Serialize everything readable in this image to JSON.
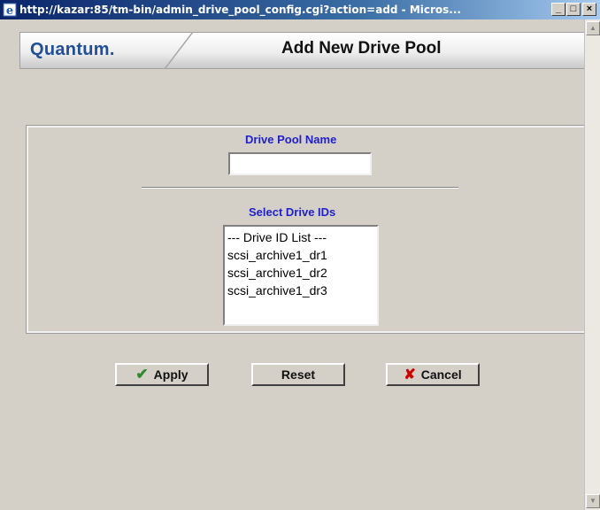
{
  "window": {
    "title": "http://kazar:85/tm-bin/admin_drive_pool_config.cgi?action=add - Micros..."
  },
  "header": {
    "logo": "Quantum.",
    "title": "Add New Drive Pool"
  },
  "form": {
    "pool_name_label": "Drive Pool Name",
    "pool_name_value": "",
    "select_label": "Select Drive IDs",
    "drive_ids": [
      "--- Drive ID List ---",
      "scsi_archive1_dr1",
      "scsi_archive1_dr2",
      "scsi_archive1_dr3"
    ]
  },
  "buttons": {
    "apply": "Apply",
    "reset": "Reset",
    "cancel": "Cancel"
  },
  "icons": {
    "apply": "checkmark-icon",
    "cancel": "x-icon"
  },
  "colors": {
    "label_blue": "#2020d0",
    "logo_blue": "#1f4e9a",
    "check_green": "#2e8b2e",
    "cancel_red": "#d00000"
  }
}
